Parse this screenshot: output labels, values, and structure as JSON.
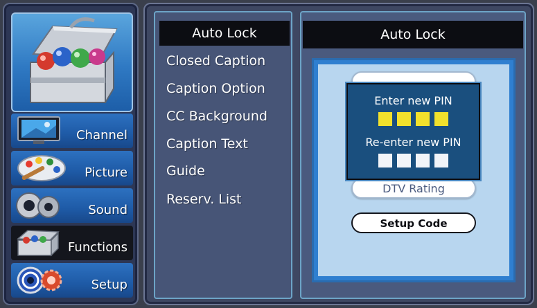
{
  "nav": {
    "items": [
      {
        "label": "Channel",
        "icon": "tv-icon",
        "selected": false
      },
      {
        "label": "Picture",
        "icon": "palette-icon",
        "selected": false
      },
      {
        "label": "Sound",
        "icon": "speaker-icon",
        "selected": false
      },
      {
        "label": "Functions",
        "icon": "toolbox-icon",
        "selected": true
      },
      {
        "label": "Setup",
        "icon": "gears-icon",
        "selected": false
      }
    ],
    "hero_icon": "toolbox-icon"
  },
  "menu": {
    "items": [
      {
        "label": "Auto Lock",
        "selected": true
      },
      {
        "label": "Closed Caption",
        "selected": false
      },
      {
        "label": "Caption Option",
        "selected": false
      },
      {
        "label": "CC Background",
        "selected": false
      },
      {
        "label": "Caption Text",
        "selected": false
      },
      {
        "label": "Guide",
        "selected": false
      },
      {
        "label": "Reserv. List",
        "selected": false
      }
    ]
  },
  "detail": {
    "title": "Auto Lock",
    "buttons": {
      "top_hidden": "",
      "dtv_rating": "DTV  Rating",
      "setup_code": "Setup Code"
    }
  },
  "pin_dialog": {
    "enter_label": "Enter new PIN",
    "reenter_label": "Re-enter new PIN",
    "pin_length": 4
  },
  "colors": {
    "pin_box_active": "#f2e12c",
    "pin_box_empty": "#f2f4f8",
    "selected_bg": "#0c0d12",
    "nav_blue": "#1e5aa6"
  }
}
